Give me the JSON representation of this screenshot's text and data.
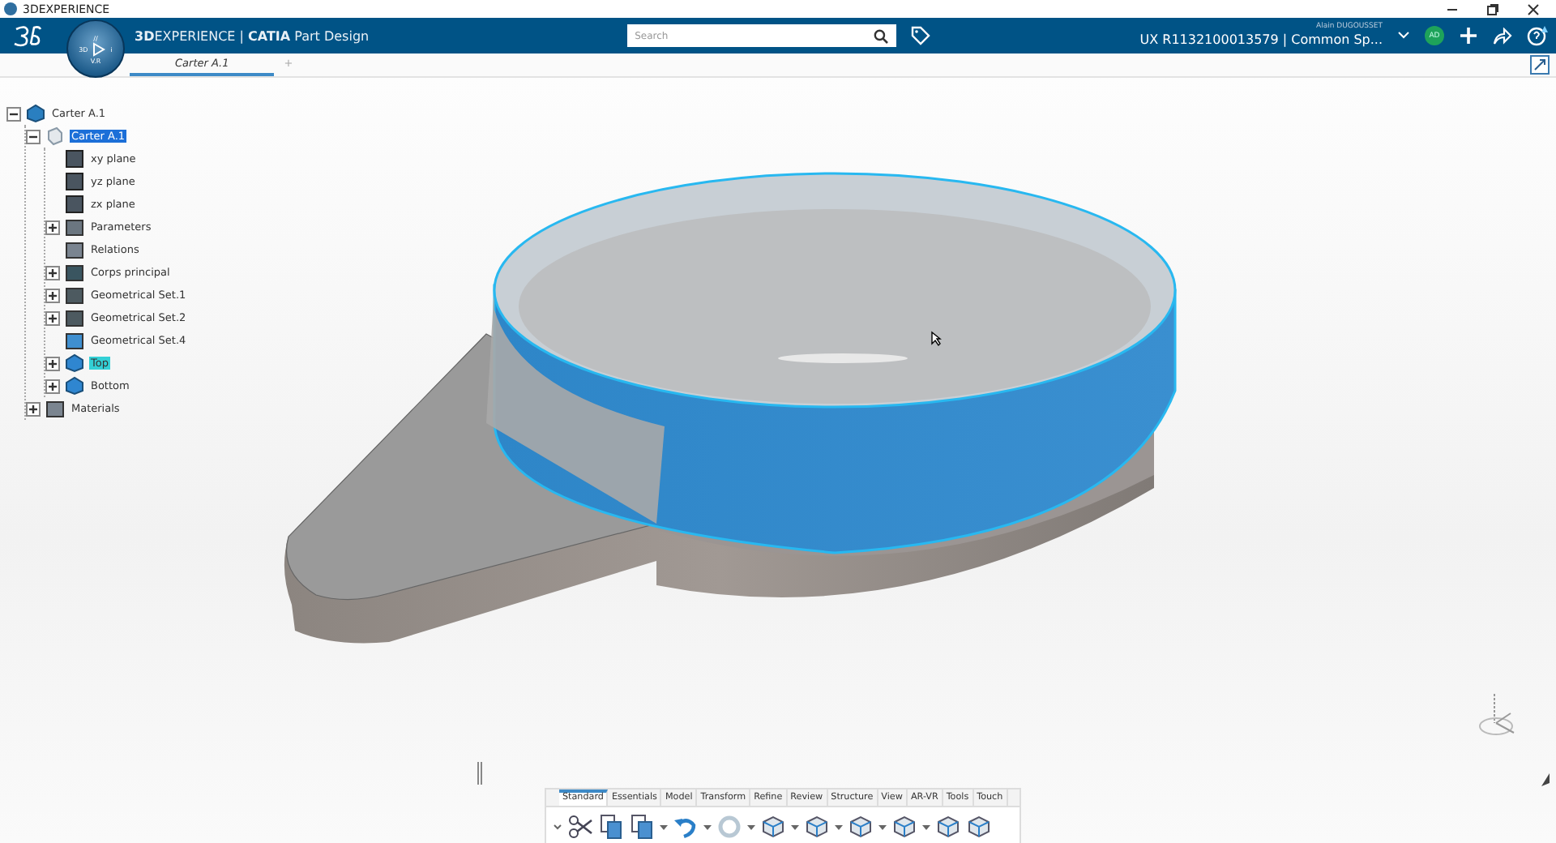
{
  "window": {
    "title": "3DEXPERIENCE"
  },
  "header": {
    "compass": {
      "top": "//",
      "left": "3D",
      "right": "i",
      "bottom": "V.R"
    },
    "app_title": "**3D**EXPERIENCE | **CATIA** Part Design",
    "search": {
      "placeholder": "Search"
    },
    "user_name": "Alain DUGOUSSET",
    "collab_space": "UX R1132100013579 | Common Sp...",
    "avatar": "AD"
  },
  "tabs": [
    {
      "label": "Carter A.1",
      "selected": true
    },
    {
      "label": "+",
      "selected": false
    }
  ],
  "tree": [
    {
      "label": "Carter A.1",
      "kind": "product",
      "expandable": true,
      "expanded": true,
      "selected": false,
      "highlighted": false,
      "children": [
        {
          "label": "Carter A.1",
          "kind": "part",
          "expandable": true,
          "expanded": true,
          "selected": true,
          "highlighted": false,
          "children": [
            {
              "label": "xy plane",
              "kind": "plane",
              "expandable": false,
              "selected": false,
              "highlighted": false
            },
            {
              "label": "yz plane",
              "kind": "plane",
              "expandable": false,
              "selected": false,
              "highlighted": false
            },
            {
              "label": "zx plane",
              "kind": "plane",
              "expandable": false,
              "selected": false,
              "highlighted": false
            },
            {
              "label": "Parameters",
              "kind": "params",
              "expandable": true,
              "expanded": false,
              "selected": false,
              "highlighted": false
            },
            {
              "label": "Relations",
              "kind": "relations",
              "expandable": false,
              "selected": false,
              "highlighted": false
            },
            {
              "label": "Corps principal",
              "kind": "body",
              "expandable": true,
              "expanded": false,
              "selected": false,
              "highlighted": false
            },
            {
              "label": "Geometrical Set.1",
              "kind": "set",
              "expandable": true,
              "expanded": false,
              "selected": false,
              "highlighted": false
            },
            {
              "label": "Geometrical Set.2",
              "kind": "set",
              "expandable": true,
              "expanded": false,
              "selected": false,
              "highlighted": false
            },
            {
              "label": "Geometrical Set.4",
              "kind": "sketchset",
              "expandable": false,
              "selected": false,
              "highlighted": false
            },
            {
              "label": "Top",
              "kind": "surface",
              "expandable": true,
              "expanded": false,
              "selected": false,
              "highlighted": true
            },
            {
              "label": "Bottom",
              "kind": "surface",
              "expandable": true,
              "expanded": false,
              "selected": false,
              "highlighted": false
            }
          ]
        },
        {
          "label": "Materials",
          "kind": "materials",
          "expandable": true,
          "expanded": false,
          "selected": false,
          "highlighted": false
        }
      ]
    }
  ],
  "action_bar": {
    "tabs": [
      {
        "label": "Standard",
        "selected": true
      },
      {
        "label": "Essentials",
        "selected": false
      },
      {
        "label": "Model",
        "selected": false
      },
      {
        "label": "Transform",
        "selected": false
      },
      {
        "label": "Refine",
        "selected": false
      },
      {
        "label": "Review",
        "selected": false
      },
      {
        "label": "Structure",
        "selected": false
      },
      {
        "label": "View",
        "selected": false
      },
      {
        "label": "AR-VR",
        "selected": false
      },
      {
        "label": "Tools",
        "selected": false
      },
      {
        "label": "Touch",
        "selected": false
      }
    ],
    "tools": [
      {
        "kind": "cut",
        "dropdown": false
      },
      {
        "kind": "copy",
        "dropdown": false
      },
      {
        "kind": "paste",
        "dropdown": true
      },
      {
        "kind": "undo",
        "dropdown": true
      },
      {
        "kind": "update",
        "dropdown": true
      },
      {
        "kind": "pad",
        "dropdown": true
      },
      {
        "kind": "chamfer",
        "dropdown": true
      },
      {
        "kind": "shell",
        "dropdown": true
      },
      {
        "kind": "hole",
        "dropdown": true
      },
      {
        "kind": "split",
        "dropdown": false
      },
      {
        "kind": "draft",
        "dropdown": false
      }
    ]
  }
}
